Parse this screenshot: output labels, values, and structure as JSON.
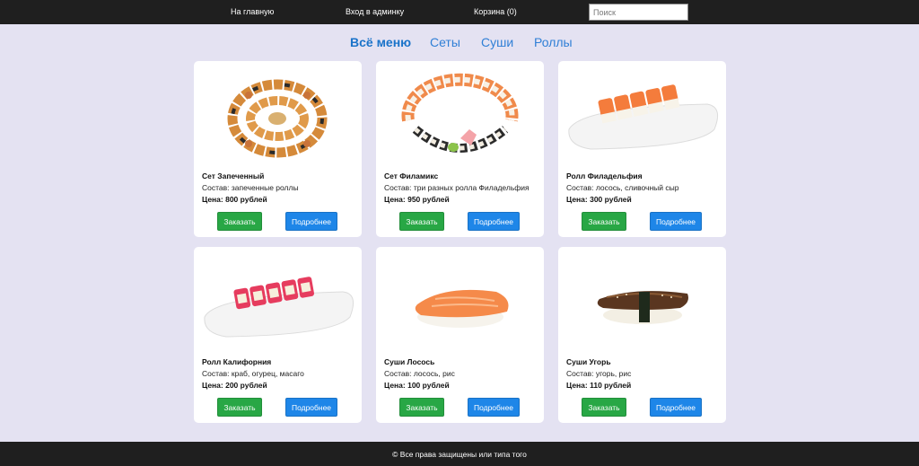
{
  "nav": {
    "home": "На главную",
    "admin": "Вход в админку",
    "cart": "Корзина (0)",
    "search_placeholder": "Поиск"
  },
  "tabs": [
    {
      "label": "Всё меню",
      "active": true
    },
    {
      "label": "Сеты",
      "active": false
    },
    {
      "label": "Суши",
      "active": false
    },
    {
      "label": "Роллы",
      "active": false
    }
  ],
  "products": [
    {
      "name": "Сет Запеченный",
      "desc": "Состав: запеченные роллы",
      "price": "Цена: 800 рублей",
      "order": "Заказать",
      "more": "Подробнее",
      "image": "baked-rolls-set-image"
    },
    {
      "name": "Сет Филамикс",
      "desc": "Состав: три разных ролла Филадельфия",
      "price": "Цена: 950 рублей",
      "order": "Заказать",
      "more": "Подробнее",
      "image": "philamix-set-image"
    },
    {
      "name": "Ролл Филадельфия",
      "desc": "Состав: лосось, сливочный сыр",
      "price": "Цена: 300 рублей",
      "order": "Заказать",
      "more": "Подробнее",
      "image": "philadelphia-roll-image"
    },
    {
      "name": "Ролл Калифорния",
      "desc": "Состав: краб, огурец, масаго",
      "price": "Цена: 200 рублей",
      "order": "Заказать",
      "more": "Подробнее",
      "image": "california-roll-image"
    },
    {
      "name": "Суши Лосось",
      "desc": "Состав: лосось, рис",
      "price": "Цена: 100 рублей",
      "order": "Заказать",
      "more": "Подробнее",
      "image": "salmon-sushi-image"
    },
    {
      "name": "Суши Угорь",
      "desc": "Состав: угорь, рис",
      "price": "Цена: 110 рублей",
      "order": "Заказать",
      "more": "Подробнее",
      "image": "eel-sushi-image"
    }
  ],
  "footer": {
    "text": "© Все права защищены или типа того"
  },
  "colors": {
    "header_bg": "#1f1f1f",
    "page_bg": "#e4e2f2",
    "order_button": "#28a745",
    "more_button": "#1e86e8",
    "tab_link": "#2f7fd6"
  }
}
